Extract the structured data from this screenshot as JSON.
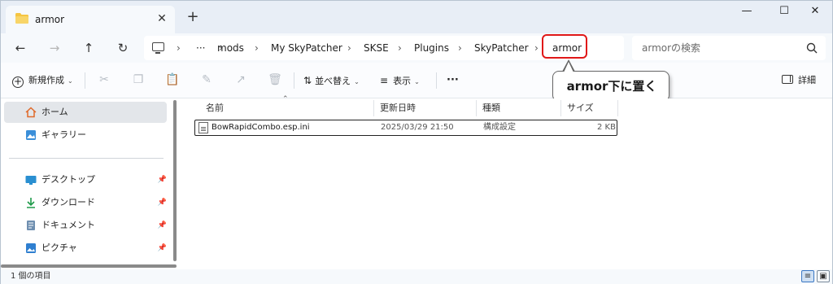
{
  "window": {
    "tab_title": "armor",
    "new_tab": "+",
    "minimize": "—",
    "maximize": "☐",
    "close": "✕",
    "tab_close": "✕"
  },
  "address": {
    "crumbs": [
      "mods",
      "My SkyPatcher",
      "SKSE",
      "Plugins",
      "SkyPatcher",
      "armor"
    ],
    "overflow": "···",
    "separator": "›",
    "search_placeholder": "armorの検索"
  },
  "toolbar": {
    "new_label": "新規作成",
    "sort_label": "並べ替え",
    "view_label": "表示",
    "more_label": "···",
    "details_label": "詳細"
  },
  "callout": {
    "text": "armor下に置く"
  },
  "sidebar": {
    "items": [
      {
        "label": "ホーム",
        "icon": "home-icon",
        "pinned": false
      },
      {
        "label": "ギャラリー",
        "icon": "gallery-icon",
        "pinned": false
      },
      {
        "label": "デスクトップ",
        "icon": "desktop-icon",
        "pinned": true
      },
      {
        "label": "ダウンロード",
        "icon": "download-icon",
        "pinned": true
      },
      {
        "label": "ドキュメント",
        "icon": "document-icon",
        "pinned": true
      },
      {
        "label": "ピクチャ",
        "icon": "pictures-icon",
        "pinned": true
      }
    ]
  },
  "filelist": {
    "columns": [
      "名前",
      "更新日時",
      "種類",
      "サイズ"
    ],
    "files": [
      {
        "name": "BowRapidCombo.esp.ini",
        "modified": "2025/03/29 21:50",
        "type": "構成設定",
        "size": "2 KB"
      }
    ]
  },
  "status": {
    "text": "1 個の項目"
  },
  "colors": {
    "highlight": "#e01818",
    "accent": "#3b78c4",
    "folder": "#f5c542"
  }
}
